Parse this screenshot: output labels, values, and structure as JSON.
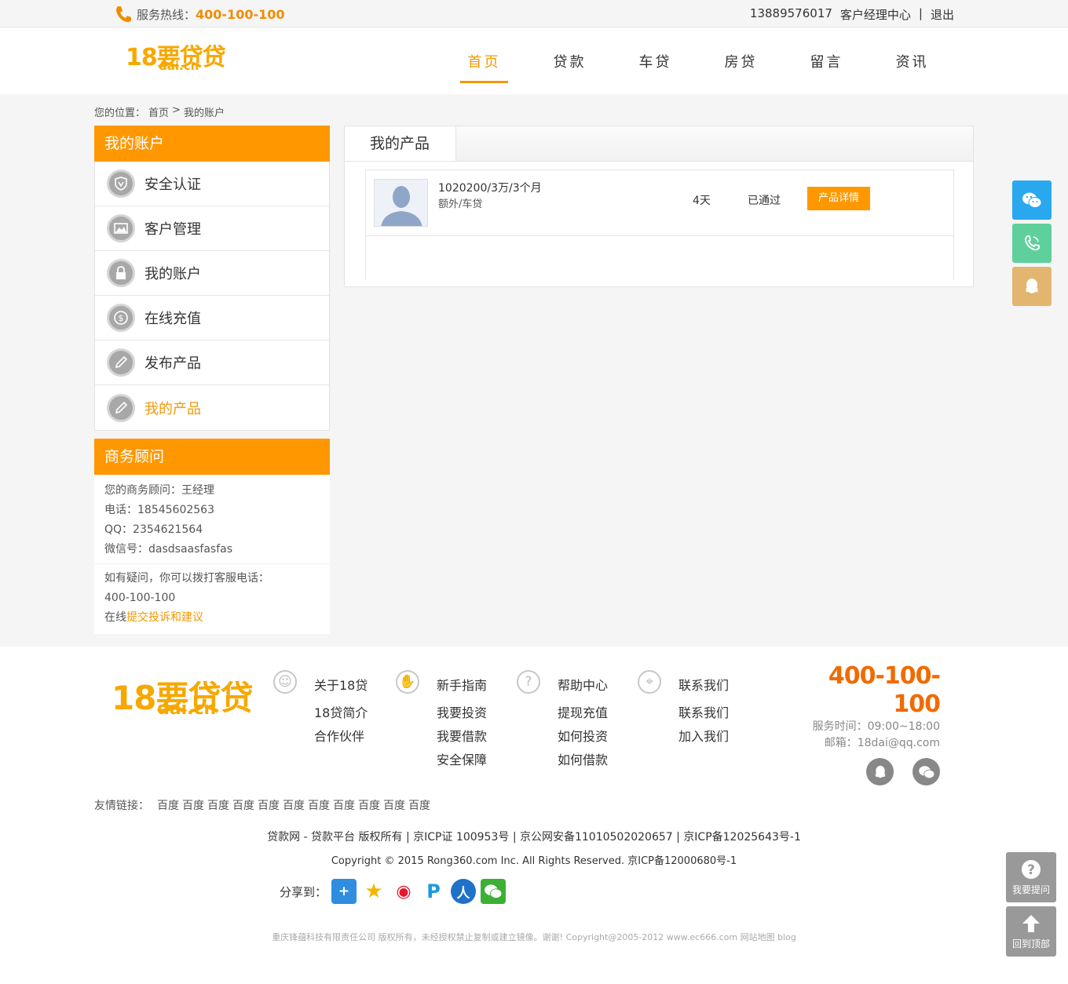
{
  "topbar": {
    "hotline_label": "服务热线：",
    "hotline_number": "400-100-100",
    "user_phone": "13889576017",
    "manager_center": "客户经理中心",
    "separator": "|",
    "logout": "退出"
  },
  "logo": {
    "line1": "18要贷贷",
    "line2": "dai.cn"
  },
  "nav": [
    {
      "label": "首页"
    },
    {
      "label": "贷款"
    },
    {
      "label": "车贷"
    },
    {
      "label": "房贷"
    },
    {
      "label": "留言"
    },
    {
      "label": "资讯"
    }
  ],
  "breadcrumb": {
    "prefix": "您的位置：",
    "home": "首页",
    "sep": ">",
    "current": "我的账户"
  },
  "sidebar": {
    "title": "我的账户",
    "items": [
      {
        "label": "安全认证",
        "icon": "shield-icon"
      },
      {
        "label": "客户管理",
        "icon": "image-icon"
      },
      {
        "label": "我的账户",
        "icon": "lock-icon"
      },
      {
        "label": "在线充值",
        "icon": "coin-icon"
      },
      {
        "label": "发布产品",
        "icon": "pencil-icon"
      },
      {
        "label": "我的产品",
        "icon": "pencil-icon"
      }
    ]
  },
  "advisor": {
    "title": "商务顾问",
    "name_line": "您的商务顾问：王经理",
    "phone_line": "电话：18545602563",
    "qq_line": "QQ：2354621564",
    "wechat_line": "微信号：dasdsaasfasfas",
    "question_line": "如有疑问，你可以拨打客服电话：",
    "service_number": "400-100-100",
    "online_prefix": "在线",
    "complaint_link": "提交投诉和建议"
  },
  "content": {
    "tab": "我的产品",
    "product": {
      "title": "1020200/3万/3个月",
      "subtitle": "额外/车贷",
      "days": "4天",
      "status": "已通过",
      "detail_button": "产品详情"
    }
  },
  "float_buttons": {
    "ask": "我要提问",
    "top": "回到顶部"
  },
  "footer": {
    "columns": [
      {
        "head": "关于18贷",
        "icon": "smile-icon",
        "glyph": "☺",
        "links": [
          "18贷简介",
          "合作伙伴"
        ]
      },
      {
        "head": "新手指南",
        "icon": "hand-icon",
        "glyph": "✋",
        "links": [
          "我要投资",
          "我要借款",
          "安全保障"
        ]
      },
      {
        "head": "帮助中心",
        "icon": "question-icon",
        "glyph": "?",
        "links": [
          "提现充值",
          "如何投资",
          "如何借款"
        ]
      },
      {
        "head": "联系我们",
        "icon": "location-icon",
        "glyph": "⌖",
        "links": [
          "联系我们",
          "加入我们"
        ]
      }
    ],
    "phone": "400-100-100",
    "service_time": "服务时间：09:00~18:00",
    "email": "邮箱：18dai@qq.com",
    "friend_label": "友情链接：",
    "friend_links": [
      "百度",
      "百度",
      "百度",
      "百度",
      "百度",
      "百度",
      "百度",
      "百度",
      "百度",
      "百度",
      "百度"
    ],
    "copy1": "贷款网 - 贷款平台 版权所有 | 京ICP证 100953号 | 京公网安备11010502020657 | 京ICP备12025643号-1",
    "copy2": "Copyright © 2015 Rong360.com Inc. All Rights Reserved. 京ICP备12000680号-1",
    "share_label": "分享到：",
    "copy3": "重庆锋蕴科技有限责任公司 版权所有，未经授权禁止复制或建立镜像。谢谢! Copyright@2005-2012 www.ec666.com 网站地图 blog"
  },
  "colors": {
    "accent": "#ff9800",
    "wechat": "#29a8ef",
    "phone": "#5fd09b",
    "qq": "#e2b66f"
  }
}
